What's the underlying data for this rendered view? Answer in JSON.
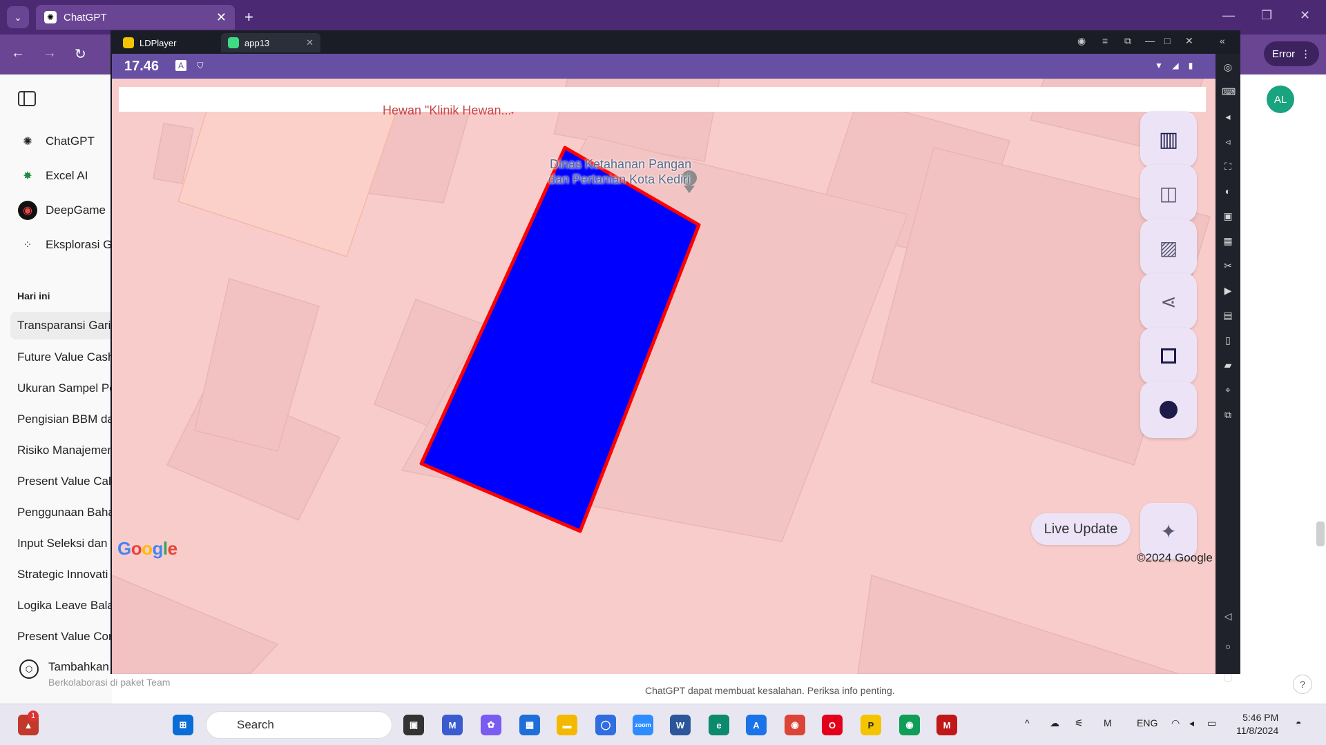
{
  "browser": {
    "tab_title": "ChatGPT",
    "tab_close": "✕",
    "new_tab": "+",
    "error_label": "Error"
  },
  "sidebar": {
    "apps": [
      {
        "label": "ChatGPT",
        "icon": "openai-icon"
      },
      {
        "label": "Excel AI",
        "icon": "excel-ai-icon"
      },
      {
        "label": "DeepGame",
        "icon": "gamepad-icon"
      },
      {
        "label": "Eksplorasi G",
        "icon": "grid-icon"
      }
    ],
    "section_today": "Hari ini",
    "history": [
      "Transparansi Garis",
      "Future Value Cash",
      "Ukuran Sampel Pe",
      "Pengisian BBM da",
      "Risiko Manajemen",
      "Present Value Calc",
      "Penggunaan Baha",
      "Input Seleksi dan",
      "Strategic Innovati",
      "Logika Leave Bala",
      "Present Value Cor"
    ],
    "footer_title": "Tambahkan",
    "footer_sub": "Berkolaborasi di paket Team"
  },
  "chat": {
    "avatar": "AL",
    "disclaimer": "ChatGPT dapat membuat kesalahan. Periksa info penting.",
    "help": "?"
  },
  "ldplayer": {
    "tabs": [
      "LDPlayer",
      "app13"
    ],
    "status_time": "17.46"
  },
  "map": {
    "poi_top": "Hewan \"Klinik Hewan...",
    "poi_line1": "Dinas Ketahanan Pangan",
    "poi_line2": "dan Pertanian Kota Kediri",
    "live_update": "Live Update",
    "google": "Google",
    "copyright": "©2024 Google",
    "polygon_fill": "#0000ff",
    "polygon_stroke": "#ff0000",
    "fab_buttons": [
      "map-icon",
      "satellite-icon",
      "image-icon",
      "share-icon",
      "square-icon",
      "dot-icon",
      "layers-icon"
    ]
  },
  "taskbar": {
    "search_placeholder": "Search",
    "lang": "ENG",
    "time": "5:46 PM",
    "date": "11/8/2024",
    "notif_badge": "1"
  }
}
